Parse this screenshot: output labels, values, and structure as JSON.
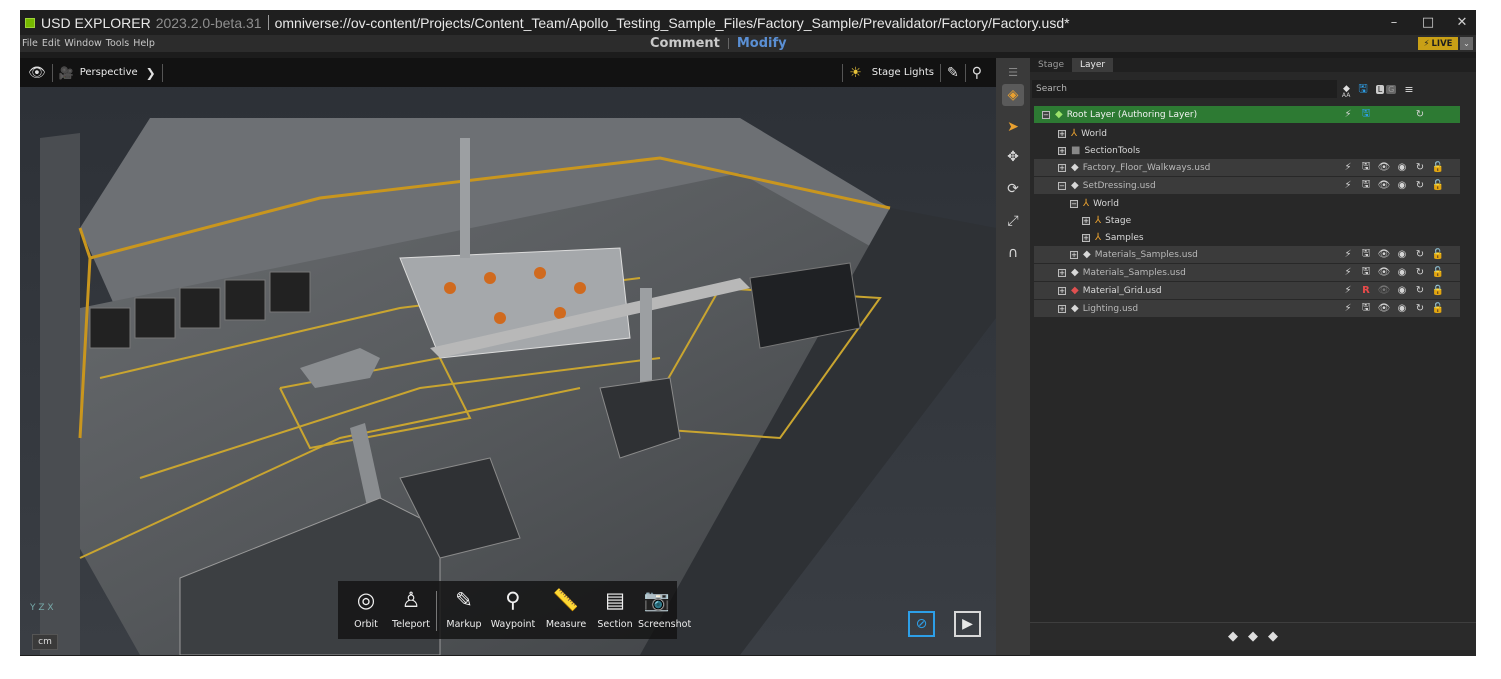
{
  "titlebar": {
    "app_name": "USD EXPLORER",
    "app_version": "2023.2.0-beta.31",
    "file_path": "omniverse://ov-content/Projects/Content_Team/Apollo_Testing_Sample_Files/Factory_Sample/Prevalidator/Factory/Factory.usd*",
    "minimize_glyph": "–",
    "maximize_glyph": "□",
    "close_glyph": "✕"
  },
  "menubar": {
    "items": [
      "File",
      "Edit",
      "Window",
      "Tools",
      "Help"
    ],
    "mode_comment": "Comment",
    "mode_modify": "Modify",
    "live_label": "LIVE"
  },
  "viewport": {
    "camera_label": "Perspective",
    "lights_label": "Stage Lights",
    "units": "cm",
    "axis_label": "Y Z X"
  },
  "tools": [
    {
      "label": "Orbit",
      "icon": "orbit-icon",
      "glyph": "◎"
    },
    {
      "label": "Teleport",
      "icon": "teleport-icon",
      "glyph": "♙"
    },
    {
      "label": "Markup",
      "icon": "markup-icon",
      "glyph": "✎"
    },
    {
      "label": "Waypoint",
      "icon": "waypoint-icon",
      "glyph": "⚲"
    },
    {
      "label": "Measure",
      "icon": "measure-icon",
      "glyph": "📏"
    },
    {
      "label": "Section",
      "icon": "section-icon",
      "glyph": "▤"
    },
    {
      "label": "Screenshot",
      "icon": "camera-icon",
      "glyph": "📷"
    }
  ],
  "panel": {
    "tabs": [
      "Stage",
      "Layer"
    ],
    "active_tab": "Layer",
    "search_placeholder": "Search",
    "auto_label": "AA"
  },
  "layers": [
    {
      "label": "Root Layer (Authoring Layer)",
      "kind": "root",
      "indent": 0
    },
    {
      "label": "World",
      "kind": "prim",
      "indent": 1
    },
    {
      "label": "SectionTools",
      "kind": "prim",
      "indent": 1
    },
    {
      "label": "Factory_Floor_Walkways.usd",
      "kind": "layer",
      "indent": 1
    },
    {
      "label": "SetDressing.usd",
      "kind": "layer",
      "indent": 1
    },
    {
      "label": "World",
      "kind": "prim",
      "indent": 2
    },
    {
      "label": "Stage",
      "kind": "prim",
      "indent": 3
    },
    {
      "label": "Samples",
      "kind": "prim",
      "indent": 3
    },
    {
      "label": "Materials_Samples.usd",
      "kind": "layer",
      "indent": 2
    },
    {
      "label": "Materials_Samples.usd",
      "kind": "layer",
      "indent": 1
    },
    {
      "label": "Material_Grid.usd",
      "kind": "layer",
      "indent": 1
    },
    {
      "label": "Lighting.usd",
      "kind": "layer",
      "indent": 1
    }
  ],
  "colors": {
    "accent_blue": "#2d9fe8",
    "live_yellow": "#c9a016",
    "root_green": "#2d7a33",
    "nvidia_green": "#76b900"
  }
}
